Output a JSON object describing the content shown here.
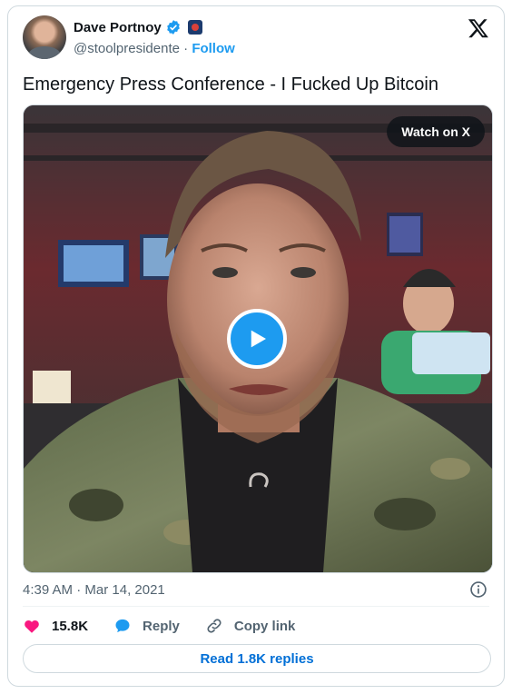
{
  "author": {
    "display_name": "Dave Portnoy",
    "handle": "@stoolpresidente",
    "separator": "·",
    "follow_label": "Follow"
  },
  "tweet": {
    "text": "Emergency Press Conference - I Fucked Up Bitcoin",
    "watch_label": "Watch on X",
    "time": "4:39 AM",
    "date": "Mar 14, 2021"
  },
  "actions": {
    "likes": "15.8K",
    "reply_label": "Reply",
    "copy_label": "Copy link",
    "read_replies": "Read 1.8K replies"
  },
  "icons": {
    "verified": "verified-badge-icon",
    "affiliate": "affiliate-badge-icon",
    "brand": "x-logo-icon",
    "play": "play-icon",
    "info": "info-icon",
    "heart": "heart-icon",
    "reply": "reply-bubble-icon",
    "link": "link-icon"
  },
  "colors": {
    "accent": "#1d9bf0",
    "heart": "#f91880",
    "link_text": "#006fd6",
    "muted": "#536471"
  }
}
